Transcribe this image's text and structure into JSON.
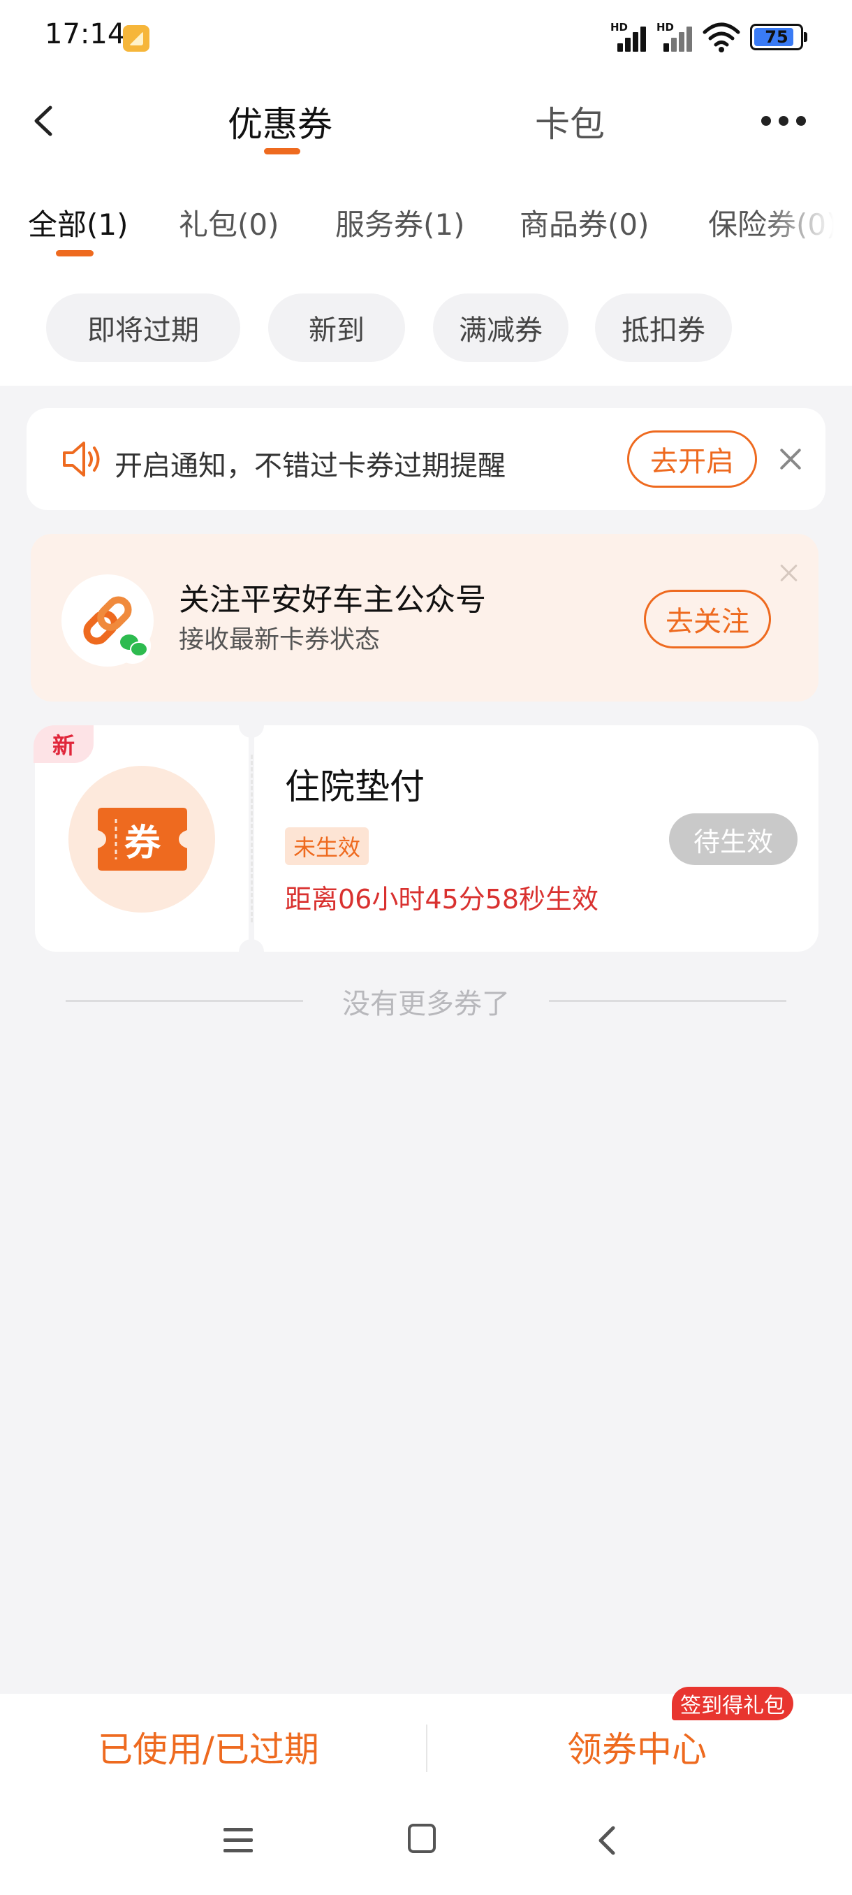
{
  "status_bar": {
    "time": "17:14",
    "signal_hd_1": "HD",
    "signal_hd_2": "HD",
    "battery": "75",
    "icons": [
      "app-notification-icon",
      "signal-icon",
      "wifi-icon",
      "battery-icon"
    ]
  },
  "header": {
    "tabs": [
      {
        "label": "优惠券",
        "active": true
      },
      {
        "label": "卡包",
        "active": false
      }
    ],
    "back_icon": "chevron-left-icon",
    "more_icon": "more-dots-icon"
  },
  "categories": [
    {
      "label": "全部(1)",
      "active": true
    },
    {
      "label": "礼包(0)",
      "active": false
    },
    {
      "label": "服务券(1)",
      "active": false
    },
    {
      "label": "商品券(0)",
      "active": false
    },
    {
      "label": "保险券(0)",
      "active": false
    }
  ],
  "filters": [
    "即将过期",
    "新到",
    "满减券",
    "抵扣券"
  ],
  "notice": {
    "text": "开启通知，不错过卡券过期提醒",
    "button": "去开启",
    "icon": "speaker-icon"
  },
  "follow_card": {
    "title": "关注平安好车主公众号",
    "subtitle": "接收最新卡券状态",
    "button": "去关注"
  },
  "coupon": {
    "badge": "新",
    "icon_text": "券",
    "name": "住院垫付",
    "status_tag": "未生效",
    "countdown": "距离06小时45分58秒生效",
    "action": "待生效"
  },
  "end_text": "没有更多券了",
  "bottom_bar": {
    "used_expired": "已使用/已过期",
    "coupon_center": "领券中心",
    "signin_badge": "签到得礼包"
  },
  "colors": {
    "accent": "#ee6a1f",
    "red": "#d9312f",
    "background": "#f4f4f6"
  }
}
